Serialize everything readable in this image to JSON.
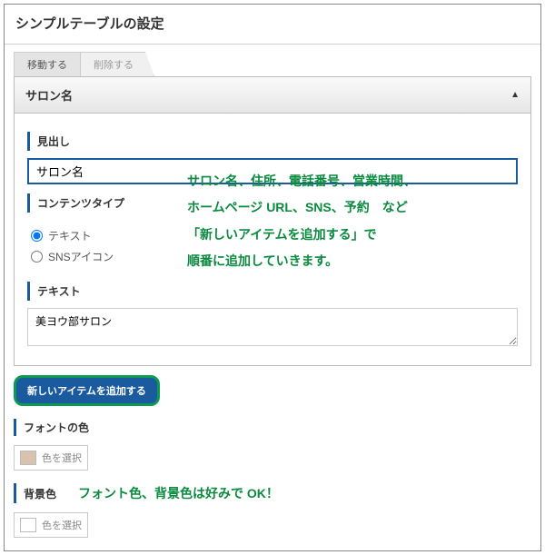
{
  "panel": {
    "title": "シンプルテーブルの設定"
  },
  "tabs": {
    "move": "移動する",
    "delete": "削除する"
  },
  "accordion": {
    "header": "サロン名"
  },
  "labels": {
    "heading": "見出し",
    "contentType": "コンテンツタイプ",
    "text": "テキスト",
    "fontColor": "フォントの色",
    "bgColor": "背景色"
  },
  "inputs": {
    "heading_value": "サロン名",
    "text_value": "美ヨウ部サロン"
  },
  "radios": {
    "text": "テキスト",
    "sns": "SNSアイコン"
  },
  "buttons": {
    "addItem": "新しいアイテムを追加する",
    "pickColor": "色を選択"
  },
  "annotations": {
    "main": "サロン名、住所、電話番号、営業時間、\nホームページ URL、SNS、予約　など\n「新しいアイテムを追加する」で\n順番に追加していきます。",
    "colors": "フォント色、背景色は好みで OK！"
  }
}
